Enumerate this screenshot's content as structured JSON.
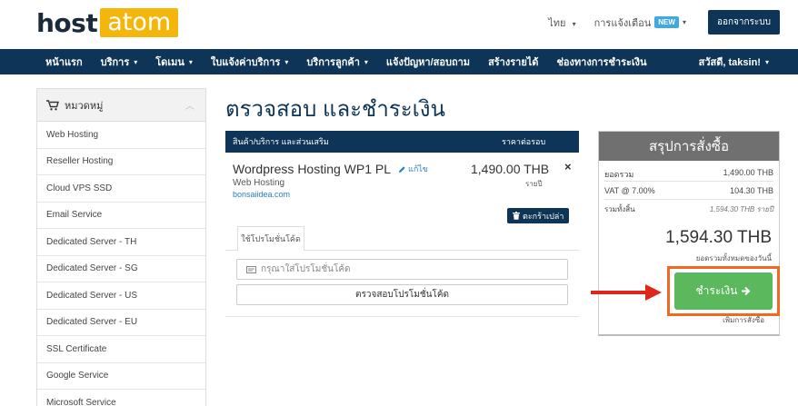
{
  "header": {
    "logo_left": "host",
    "logo_right": "atom",
    "language": "ไทย",
    "notifications": "การแจ้งเตือน",
    "new_badge": "NEW",
    "logout": "ออกจากระบบ"
  },
  "nav": {
    "items": [
      "หน้าแรก",
      "บริการ",
      "โดเมน",
      "ใบแจ้งค่าบริการ",
      "บริการลูกค้า",
      "แจ้งปัญหา/สอบถาม",
      "สร้างรายได้",
      "ช่องทางการชำระเงิน"
    ],
    "user": "สวัสดี, taksin!"
  },
  "sidebar": {
    "title": "หมวดหมู่",
    "items": [
      "Web Hosting",
      "Reseller Hosting",
      "Cloud VPS SSD",
      "Email Service",
      "Dedicated Server - TH",
      "Dedicated Server - SG",
      "Dedicated Server - US",
      "Dedicated Server - EU",
      "SSL Certificate",
      "Google Service",
      "Microsoft Service"
    ]
  },
  "main": {
    "title": "ตรวจสอบ และชำระเงิน"
  },
  "cart": {
    "col_product": "สินค้า/บริการ และส่วนเสริม",
    "col_price": "ราคาต่อรอบ",
    "item": {
      "name": "Wordpress Hosting WP1 PL",
      "edit": "แก้ไข",
      "group": "Web Hosting",
      "domain": "bonsaiidea.com",
      "price": "1,490.00 THB",
      "cycle": "รายปี",
      "remove": "×"
    },
    "empty_cart": "ตะกร้าเปล่า",
    "promo_tab": "ใช้โปรโมชั่นโค้ด",
    "promo_placeholder": "กรุณาใส่โปรโมชั่นโค้ด",
    "promo_button": "ตรวจสอบโปรโมชั่นโค้ด"
  },
  "summary": {
    "title": "สรุปการสั่งซื้อ",
    "subtotal_label": "ยอดรวม",
    "subtotal": "1,490.00 THB",
    "vat_label": "VAT @ 7.00%",
    "vat": "104.30 THB",
    "total_label": "รวมทั้งสิ้น",
    "total_cycle": "1,594.30 THB รายปี",
    "total": "1,594.30 THB",
    "total_caption": "ยอดรวมทั้งหมดของวันนี้",
    "checkout": "ชำระเงิน",
    "more": "เพิ่มการสั่งซื้อ"
  },
  "colors": {
    "navy": "#0e3557",
    "logo_yellow": "#f5b60c",
    "checkout_green": "#5cb85c",
    "highlight_orange": "#f26722",
    "arrow_red": "#e0261b"
  }
}
